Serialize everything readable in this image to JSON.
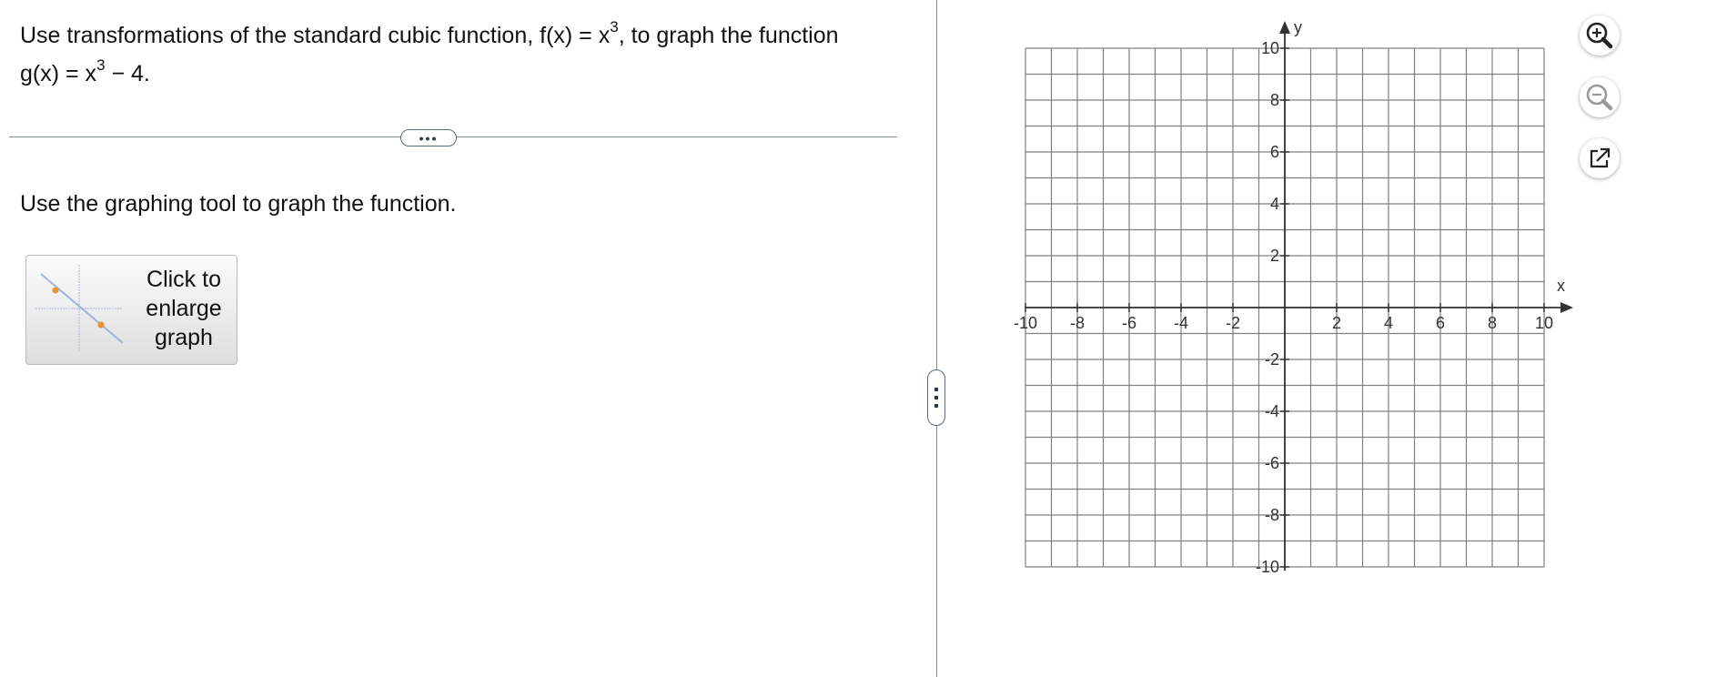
{
  "question": {
    "line1_pre": "Use transformations of the standard cubic function, f(x)",
    "line1_eq": " = x",
    "line1_exp": "3",
    "line1_post": ", to graph the function",
    "line2_pre": "g(x)",
    "line2_eq": " = x",
    "line2_exp": "3",
    "line2_post": " − 4."
  },
  "divider": {
    "dots": "•••"
  },
  "instruction": "Use the graphing tool to graph the function.",
  "enlarge_button": {
    "line1": "Click to",
    "line2": "enlarge",
    "line3": "graph"
  },
  "graph": {
    "x_label": "x",
    "y_label": "y",
    "x_ticks": [
      "-10",
      "-8",
      "-6",
      "-4",
      "-2",
      "2",
      "4",
      "6",
      "8",
      "10"
    ],
    "y_ticks": [
      "10",
      "8",
      "6",
      "4",
      "2",
      "-2",
      "-4",
      "-6",
      "-8",
      "-10"
    ]
  },
  "tools": {
    "zoom_in": "zoom-in-icon",
    "zoom_out": "zoom-out-icon",
    "popout": "external-window-icon"
  },
  "colors": {
    "grid": "#808080",
    "axis": "#333333",
    "accent": "#2b2b2b",
    "muted": "#9a9a9a"
  }
}
